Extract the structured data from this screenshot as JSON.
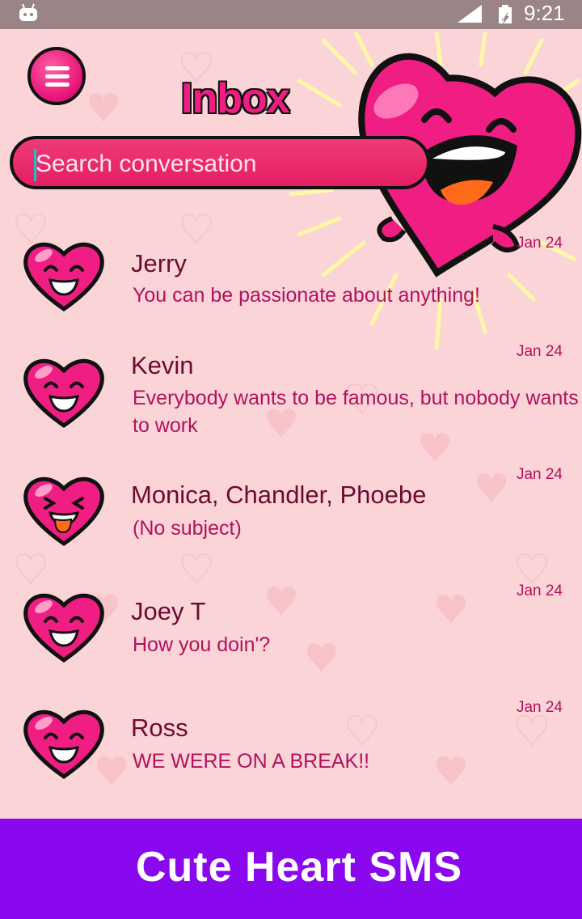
{
  "status_bar": {
    "time": "9:21"
  },
  "header": {
    "title": "Inbox",
    "menu_icon": "hamburger-menu-icon"
  },
  "search": {
    "placeholder": "Search conversation"
  },
  "conversations": [
    {
      "name": "Jerry",
      "snippet": " You can be passionate about anything!",
      "date": "Jan 24",
      "avatar": "smiling-heart"
    },
    {
      "name": "Kevin",
      "snippet": " Everybody wants to be famous, but nobody wants to work",
      "date": "Jan 24",
      "avatar": "smiling-heart"
    },
    {
      "name": "Monica, Chandler, Phoebe",
      "snippet": "(No subject)",
      "date": "Jan 24",
      "avatar": "tongue-out-heart"
    },
    {
      "name": "Joey T",
      "snippet": "How you doin'?",
      "date": "Jan 24",
      "avatar": "smiling-heart"
    },
    {
      "name": "Ross",
      "snippet": "WE WERE ON A BREAK!!",
      "date": "Jan 24",
      "avatar": "smiling-heart"
    }
  ],
  "footer": {
    "brand": "Cute Heart SMS"
  },
  "colors": {
    "accent": "#f01e82",
    "footer": "#8a08ee",
    "background": "#fbd4d8"
  }
}
